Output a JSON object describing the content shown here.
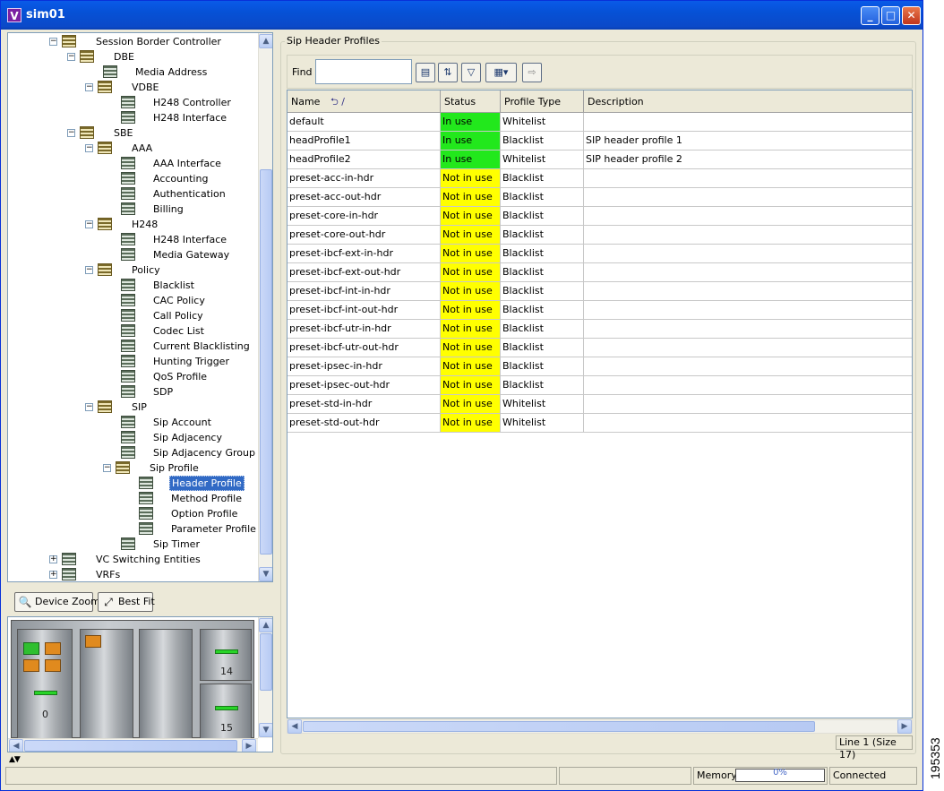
{
  "window": {
    "title": "sim01",
    "app_icon_letter": "V"
  },
  "tree": {
    "items": [
      {
        "label": "Session Border Controller",
        "level": 0,
        "expander": "minus",
        "icon": "folder"
      },
      {
        "label": "DBE",
        "level": 1,
        "expander": "minus",
        "icon": "folder"
      },
      {
        "label": "Media Address",
        "level": 2,
        "expander": "",
        "icon": "table"
      },
      {
        "label": "VDBE",
        "level": 2,
        "expander": "minus",
        "icon": "folder"
      },
      {
        "label": "H248 Controller",
        "level": 3,
        "expander": "",
        "icon": "table"
      },
      {
        "label": "H248 Interface",
        "level": 3,
        "expander": "",
        "icon": "table"
      },
      {
        "label": "SBE",
        "level": 1,
        "expander": "minus",
        "icon": "folder"
      },
      {
        "label": "AAA",
        "level": 2,
        "expander": "minus",
        "icon": "folder"
      },
      {
        "label": "AAA Interface",
        "level": 3,
        "expander": "",
        "icon": "table"
      },
      {
        "label": "Accounting",
        "level": 3,
        "expander": "",
        "icon": "table"
      },
      {
        "label": "Authentication",
        "level": 3,
        "expander": "",
        "icon": "table"
      },
      {
        "label": "Billing",
        "level": 3,
        "expander": "",
        "icon": "table"
      },
      {
        "label": "H248",
        "level": 2,
        "expander": "minus",
        "icon": "folder"
      },
      {
        "label": "H248 Interface",
        "level": 3,
        "expander": "",
        "icon": "table"
      },
      {
        "label": "Media Gateway",
        "level": 3,
        "expander": "",
        "icon": "table"
      },
      {
        "label": "Policy",
        "level": 2,
        "expander": "minus",
        "icon": "folder"
      },
      {
        "label": "Blacklist",
        "level": 3,
        "expander": "",
        "icon": "table"
      },
      {
        "label": "CAC Policy",
        "level": 3,
        "expander": "",
        "icon": "table"
      },
      {
        "label": "Call Policy",
        "level": 3,
        "expander": "",
        "icon": "table"
      },
      {
        "label": "Codec List",
        "level": 3,
        "expander": "",
        "icon": "table"
      },
      {
        "label": "Current Blacklisting",
        "level": 3,
        "expander": "",
        "icon": "table"
      },
      {
        "label": "Hunting Trigger",
        "level": 3,
        "expander": "",
        "icon": "table"
      },
      {
        "label": "QoS Profile",
        "level": 3,
        "expander": "",
        "icon": "table"
      },
      {
        "label": "SDP",
        "level": 3,
        "expander": "",
        "icon": "table"
      },
      {
        "label": "SIP",
        "level": 2,
        "expander": "minus",
        "icon": "folder"
      },
      {
        "label": "Sip Account",
        "level": 3,
        "expander": "",
        "icon": "table"
      },
      {
        "label": "Sip Adjacency",
        "level": 3,
        "expander": "",
        "icon": "table"
      },
      {
        "label": "Sip Adjacency Group",
        "level": 3,
        "expander": "",
        "icon": "table"
      },
      {
        "label": "Sip Profile",
        "level": 3,
        "expander": "minus",
        "icon": "folder"
      },
      {
        "label": "Header Profile",
        "level": 4,
        "expander": "",
        "icon": "table",
        "selected": true
      },
      {
        "label": "Method Profile",
        "level": 4,
        "expander": "",
        "icon": "table"
      },
      {
        "label": "Option Profile",
        "level": 4,
        "expander": "",
        "icon": "table"
      },
      {
        "label": "Parameter Profile",
        "level": 4,
        "expander": "",
        "icon": "table"
      },
      {
        "label": "Sip Timer",
        "level": 3,
        "expander": "",
        "icon": "table"
      },
      {
        "label": "VC Switching Entities",
        "level": 0,
        "expander": "plus",
        "icon": "table"
      },
      {
        "label": "VRFs",
        "level": 0,
        "expander": "plus",
        "icon": "table"
      }
    ]
  },
  "zoom": {
    "device_zoom_label": "Device Zoom",
    "best_fit_label": "Best Fit"
  },
  "device": {
    "slot_a": "0",
    "slot_b": "14",
    "slot_c": "15"
  },
  "group_title": "Sip Header Profiles",
  "find": {
    "label": "Find :",
    "value": ""
  },
  "table": {
    "columns": [
      "Name",
      "Status",
      "Profile Type",
      "Description"
    ],
    "sort_indicator": "⮌ /",
    "rows": [
      {
        "name": "default",
        "status": "In use",
        "profile_type": "Whitelist",
        "description": ""
      },
      {
        "name": "headProfile1",
        "status": "In use",
        "profile_type": "Blacklist",
        "description": "SIP header profile 1"
      },
      {
        "name": "headProfile2",
        "status": "In use",
        "profile_type": "Whitelist",
        "description": "SIP header profile 2"
      },
      {
        "name": "preset-acc-in-hdr",
        "status": "Not in use",
        "profile_type": "Blacklist",
        "description": ""
      },
      {
        "name": "preset-acc-out-hdr",
        "status": "Not in use",
        "profile_type": "Blacklist",
        "description": ""
      },
      {
        "name": "preset-core-in-hdr",
        "status": "Not in use",
        "profile_type": "Blacklist",
        "description": ""
      },
      {
        "name": "preset-core-out-hdr",
        "status": "Not in use",
        "profile_type": "Blacklist",
        "description": ""
      },
      {
        "name": "preset-ibcf-ext-in-hdr",
        "status": "Not in use",
        "profile_type": "Blacklist",
        "description": ""
      },
      {
        "name": "preset-ibcf-ext-out-hdr",
        "status": "Not in use",
        "profile_type": "Blacklist",
        "description": ""
      },
      {
        "name": "preset-ibcf-int-in-hdr",
        "status": "Not in use",
        "profile_type": "Blacklist",
        "description": ""
      },
      {
        "name": "preset-ibcf-int-out-hdr",
        "status": "Not in use",
        "profile_type": "Blacklist",
        "description": ""
      },
      {
        "name": "preset-ibcf-utr-in-hdr",
        "status": "Not in use",
        "profile_type": "Blacklist",
        "description": ""
      },
      {
        "name": "preset-ibcf-utr-out-hdr",
        "status": "Not in use",
        "profile_type": "Blacklist",
        "description": ""
      },
      {
        "name": "preset-ipsec-in-hdr",
        "status": "Not in use",
        "profile_type": "Blacklist",
        "description": ""
      },
      {
        "name": "preset-ipsec-out-hdr",
        "status": "Not in use",
        "profile_type": "Blacklist",
        "description": ""
      },
      {
        "name": "preset-std-in-hdr",
        "status": "Not in use",
        "profile_type": "Whitelist",
        "description": ""
      },
      {
        "name": "preset-std-out-hdr",
        "status": "Not in use",
        "profile_type": "Whitelist",
        "description": ""
      }
    ]
  },
  "status_line": "Line 1 (Size 17)",
  "statusbar": {
    "memory_label": "Memory:",
    "memory_value": "0%",
    "connection": "Connected"
  },
  "figure_id": "195353",
  "colors": {
    "in_use": "#22e81c",
    "not_in_use": "#ffff00",
    "selection": "#316ac5"
  }
}
